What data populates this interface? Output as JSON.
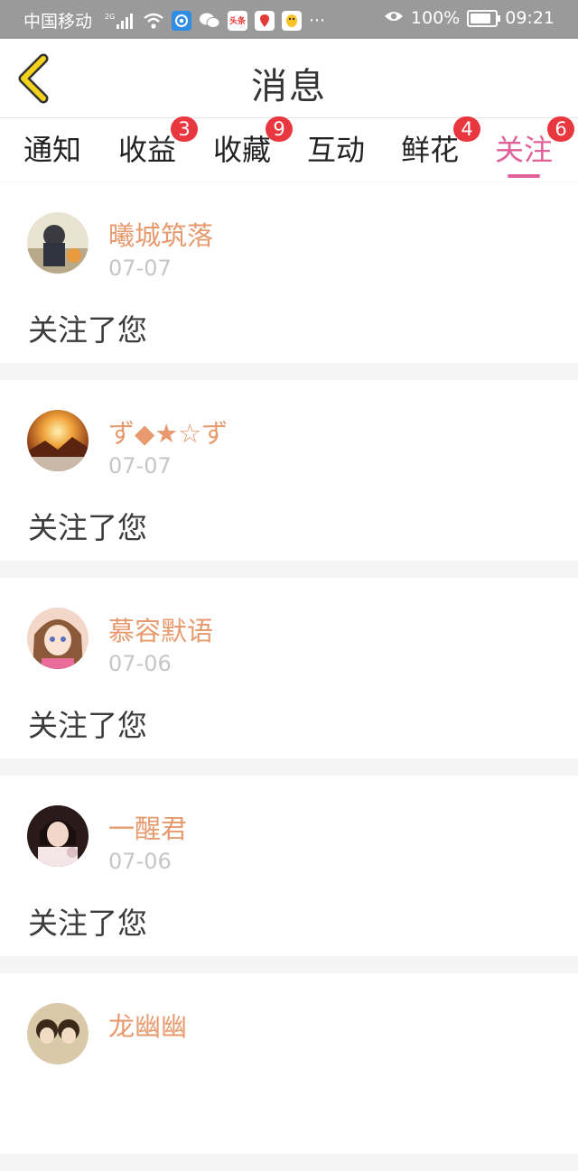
{
  "status_bar": {
    "carrier": "中国移动",
    "network": "2G",
    "app_badges": [
      "头条"
    ],
    "more": "···",
    "battery": "100%",
    "battery_level": 1.0,
    "time": "09:21"
  },
  "header": {
    "title": "消息",
    "back_icon": "chevron-left-icon"
  },
  "tabs": [
    {
      "label": "通知",
      "badge": ""
    },
    {
      "label": "收益",
      "badge": "3"
    },
    {
      "label": "收藏",
      "badge": "9"
    },
    {
      "label": "互动",
      "badge": ""
    },
    {
      "label": "鲜花",
      "badge": "4"
    },
    {
      "label": "关注",
      "badge": "6",
      "active": true
    }
  ],
  "messages": [
    {
      "name": "曦城筑落",
      "date": "07-07",
      "text": "关注了您"
    },
    {
      "name": "ず◆★☆ず",
      "date": "07-07",
      "text": "关注了您"
    },
    {
      "name": "慕容默语",
      "date": "07-06",
      "text": "关注了您"
    },
    {
      "name": "一醒君",
      "date": "07-06",
      "text": "关注了您"
    },
    {
      "name": "龙幽幽",
      "date": "",
      "text": ""
    }
  ],
  "colors": {
    "accent": "#e0609a",
    "badge": "#e8373f",
    "username": "#e79a6e",
    "back_arrow": "#f2d21a"
  }
}
